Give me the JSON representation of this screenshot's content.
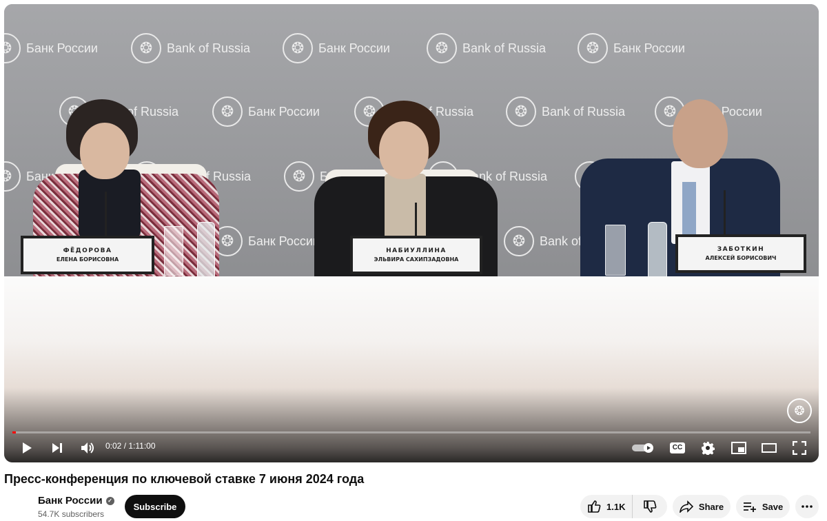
{
  "video": {
    "backdrop_logos": {
      "ru": "Банк России",
      "en": "Bank of Russia"
    },
    "nameplates": [
      {
        "surname": "ФЁДОРОВА",
        "given": "ЕЛЕНА БОРИСОВНА"
      },
      {
        "surname": "НАБИУЛЛИНА",
        "given": "ЭЛЬВИРА САХИПЗАДОВНА"
      },
      {
        "surname": "ЗАБОТКИН",
        "given": "АЛЕКСЕЙ БОРИСОВИЧ"
      }
    ],
    "watermark_icon": "eagle-emblem-icon"
  },
  "player": {
    "time_display": "0:02 / 1:11:00",
    "progress_fraction": 0.0005,
    "icons": [
      "play-icon",
      "next-icon",
      "volume-icon",
      "autoplay-toggle-icon",
      "captions-icon",
      "settings-icon",
      "miniplayer-icon",
      "theater-icon",
      "fullscreen-icon"
    ],
    "captions_label": "CC"
  },
  "meta": {
    "title": "Пресс-конференция по ключевой ставке 7 июня 2024 года",
    "channel_name": "Банк России",
    "subscribers": "54.7K subscribers",
    "subscribe_label": "Subscribe",
    "like_count": "1.1K",
    "share_label": "Share",
    "save_label": "Save"
  },
  "colors": {
    "progress": "#ff0000",
    "subscribe_bg": "#0f0f0f",
    "pill_bg": "#f2f2f2"
  }
}
